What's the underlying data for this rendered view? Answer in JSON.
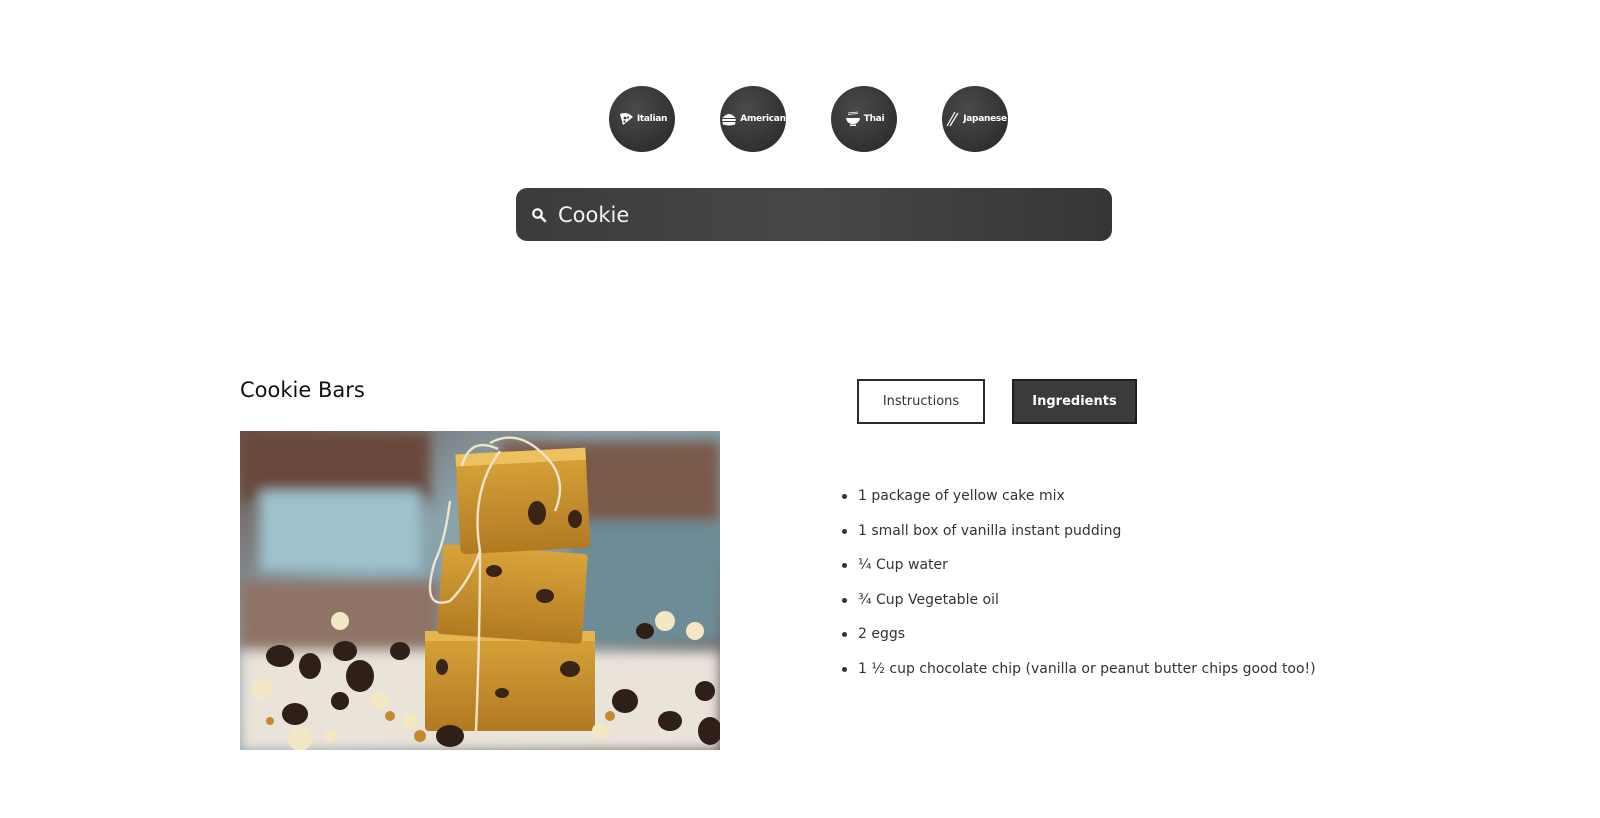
{
  "cuisines": [
    {
      "label": "Italian",
      "icon": "pizza-icon"
    },
    {
      "label": "American",
      "icon": "burger-icon"
    },
    {
      "label": "Thai",
      "icon": "noodle-bowl-icon"
    },
    {
      "label": "Japanese",
      "icon": "chopsticks-icon"
    }
  ],
  "search": {
    "value": "Cookie",
    "icon": "search-icon"
  },
  "recipe": {
    "title": "Cookie Bars",
    "tabs": {
      "instructions": "Instructions",
      "ingredients": "Ingredients",
      "active": "ingredients"
    },
    "ingredients": [
      "1 package of yellow cake mix",
      "1 small box of vanilla instant pudding",
      "¼ Cup water",
      "¾ Cup Vegetable oil",
      "2 eggs",
      "1 ½ cup chocolate chip (vanilla or peanut butter chips good too!)"
    ]
  },
  "colors": {
    "accent": "#3b3b3b",
    "search_bg": "#424242",
    "text": "#333333"
  }
}
